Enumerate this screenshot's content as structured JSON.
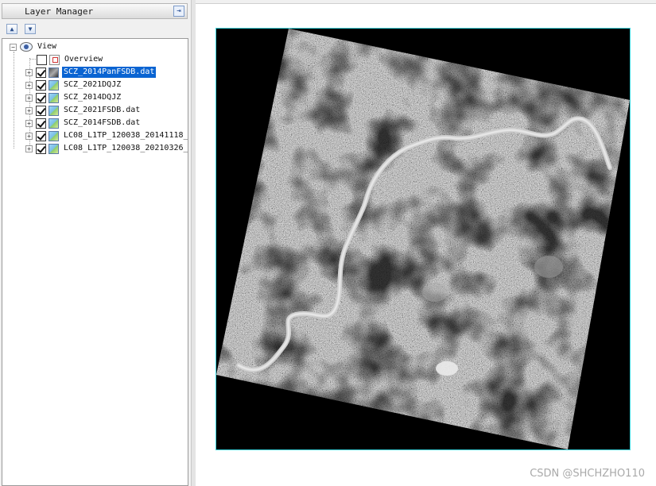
{
  "layer_manager": {
    "title": "Layer Manager",
    "toolbar": {
      "move_up_icon": "arrow-up-icon",
      "move_down_icon": "arrow-down-icon"
    },
    "tree": {
      "root": {
        "label": "View",
        "expander": "−",
        "icon": "eye-icon"
      },
      "items": [
        {
          "label": "Overview",
          "checked": false,
          "icon": "overview-icon",
          "selected": false
        },
        {
          "label": "SCZ_2014PanFSDB.dat",
          "checked": true,
          "icon": "raster-layer-icon",
          "selected": true
        },
        {
          "label": "SCZ_2021DQJZ",
          "checked": true,
          "icon": "raster-layer-icon",
          "selected": false
        },
        {
          "label": "SCZ_2014DQJZ",
          "checked": true,
          "icon": "raster-layer-icon",
          "selected": false
        },
        {
          "label": "SCZ_2021FSDB.dat",
          "checked": true,
          "icon": "raster-layer-icon",
          "selected": false
        },
        {
          "label": "SCZ_2014FSDB.dat",
          "checked": true,
          "icon": "raster-layer-icon",
          "selected": false
        },
        {
          "label": "LC08_L1TP_120038_20141118_",
          "checked": true,
          "icon": "raster-layer-icon",
          "selected": false
        },
        {
          "label": "LC08_L1TP_120038_20210326_",
          "checked": true,
          "icon": "raster-layer-icon",
          "selected": false
        }
      ],
      "expander_symbol": "+"
    }
  },
  "viewer": {
    "frame_border_color": "#3fd7e0",
    "background_color": "#000000"
  },
  "watermark": "CSDN @SHCHZHO110",
  "colors": {
    "selection": "#0a64d2",
    "panel_bg": "#f0f0f0"
  }
}
